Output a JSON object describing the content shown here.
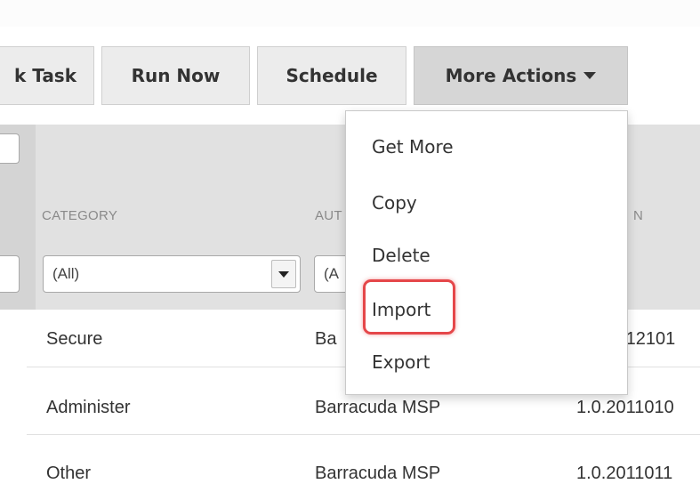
{
  "toolbar": {
    "buttons": [
      {
        "label": "k Task"
      },
      {
        "label": "Run Now"
      },
      {
        "label": "Schedule"
      },
      {
        "label": "More Actions"
      }
    ]
  },
  "columns": {
    "category": "CATEGORY",
    "author": "AUT",
    "version": "N"
  },
  "filters": {
    "category": "(All)",
    "author": "(A"
  },
  "rows": [
    {
      "category": "Secure",
      "author": "Ba",
      "version": "1.0.2012101"
    },
    {
      "category": "Administer",
      "author": "Barracuda MSP",
      "version": "1.0.2011010"
    },
    {
      "category": "Other",
      "author": "Barracuda MSP",
      "version": "1.0.2011011"
    }
  ],
  "menu": {
    "items": [
      {
        "label": "Get More"
      },
      {
        "label": "Copy"
      },
      {
        "label": "Delete"
      },
      {
        "label": "Import"
      },
      {
        "label": "Export"
      }
    ],
    "highlighted": "Import",
    "highlight_color": "#e5474a"
  }
}
